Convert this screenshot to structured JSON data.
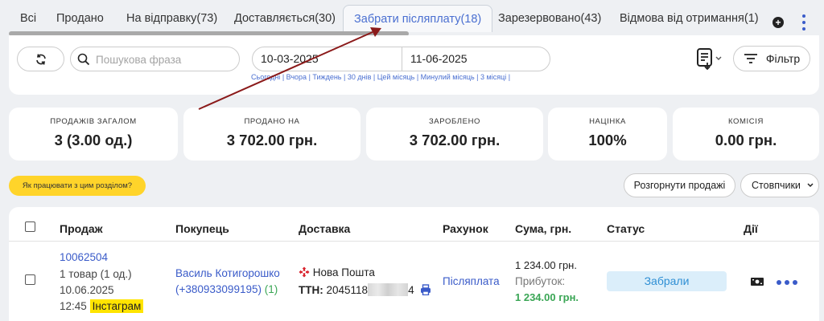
{
  "tabs": [
    {
      "label": "Всі"
    },
    {
      "label": "Продано"
    },
    {
      "label": "На відправку(73)"
    },
    {
      "label": "Доставляється(30)"
    },
    {
      "label": "Забрати післяплату(18)",
      "active": true
    },
    {
      "label": "Зарезервовано(43)"
    },
    {
      "label": "Відмова від отримання(1)"
    }
  ],
  "filters": {
    "search_placeholder": "Пошукова фраза",
    "date_from": "10-03-2025",
    "date_to": "11-06-2025",
    "quick_dates": [
      "Сьогодні",
      "Вчора",
      "Тиждень",
      "30 днів",
      "Цей місяць",
      "Минулий місяць",
      "3 місяці"
    ],
    "filter_label": "Фільтр"
  },
  "stats": [
    {
      "label": "ПРОДАЖІВ ЗАГАЛОМ",
      "value": "3 (3.00 од.)"
    },
    {
      "label": "ПРОДАНО НА",
      "value": "3 702.00 грн."
    },
    {
      "label": "ЗАРОБЛЕНО",
      "value": "3 702.00 грн."
    },
    {
      "label": "НАЦІНКА",
      "value": "100%"
    },
    {
      "label": "КОМІСІЯ",
      "value": "0.00 грн."
    }
  ],
  "help_label": "Як працювати з цим розділом?",
  "actions": {
    "expand_label": "Розгорнути продажі",
    "columns_label": "Стовпчики"
  },
  "table": {
    "headers": {
      "sale": "Продаж",
      "buyer": "Покупець",
      "delivery": "Доставка",
      "invoice": "Рахунок",
      "amount": "Сума, грн.",
      "status": "Статус",
      "actions": "Дії"
    },
    "rows": [
      {
        "sale_id": "10062504",
        "items": "1 товар (1 од.)",
        "date": "10.06.2025",
        "time": "12:45",
        "source": "Інстаграм",
        "buyer_name": "Василь Котигорошко",
        "buyer_phone": "(+380933099195)",
        "buyer_count": "(1)",
        "carrier": "Нова Пошта",
        "ttn_label": "ТТН:",
        "ttn_start": "2045118",
        "ttn_end": "4",
        "invoice": "Післяплата",
        "amount": "1 234.00 грн.",
        "profit_label": "Прибуток:",
        "profit": "1 234.00 грн.",
        "status": "Забрали"
      }
    ]
  },
  "colors": {
    "accent": "#3a5bc9",
    "arrow": "#8b1a1a",
    "help_pill": "#ffd42a",
    "highlight": "#ffe400",
    "status_bg": "#dbeefa",
    "profit": "#3aa655"
  }
}
